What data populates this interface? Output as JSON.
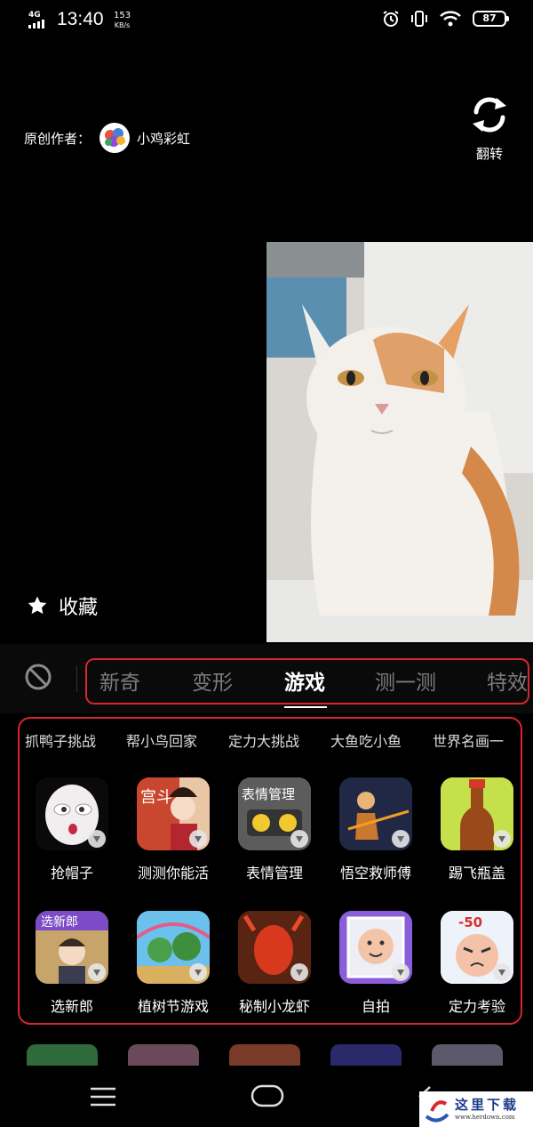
{
  "status_bar": {
    "network": "4G",
    "time": "13:40",
    "speed_value": "153",
    "speed_unit": "KB/s",
    "battery": "87"
  },
  "author": {
    "prefix": "原创作者：",
    "name": "小鸡彩虹"
  },
  "flip_label": "翻转",
  "favorite_label": "收藏",
  "tabs": [
    "新奇",
    "变形",
    "游戏",
    "测一测",
    "特效"
  ],
  "active_tab": "游戏",
  "subcategories": [
    "抓鸭子挑战",
    "帮小鸟回家",
    "定力大挑战",
    "大鱼吃小鱼",
    "世界名画一"
  ],
  "games": [
    {
      "label": "抢帽子",
      "icon": "mime-face-icon"
    },
    {
      "label": "测测你能活",
      "icon": "palace-lady-icon",
      "art_text": "宫斗"
    },
    {
      "label": "表情管理",
      "icon": "emoji-faces-icon",
      "art_text": "表情管理"
    },
    {
      "label": "悟空救师傅",
      "icon": "monkey-king-icon"
    },
    {
      "label": "踢飞瓶盖",
      "icon": "bottle-icon"
    },
    {
      "label": "选新郎",
      "icon": "groom-icon",
      "art_text": "选新郎"
    },
    {
      "label": "植树节游戏",
      "icon": "tree-icon"
    },
    {
      "label": "秘制小龙虾",
      "icon": "crayfish-icon"
    },
    {
      "label": "自拍",
      "icon": "selfie-icon"
    },
    {
      "label": "定力考验",
      "icon": "angry-face-icon",
      "art_text": "-50"
    }
  ],
  "watermark": {
    "title": "这里下载",
    "url": "www.herdown.com"
  },
  "colors": {
    "highlight": "#d8262f",
    "background": "#000000",
    "inactive_tab": "#7c7c7c"
  }
}
